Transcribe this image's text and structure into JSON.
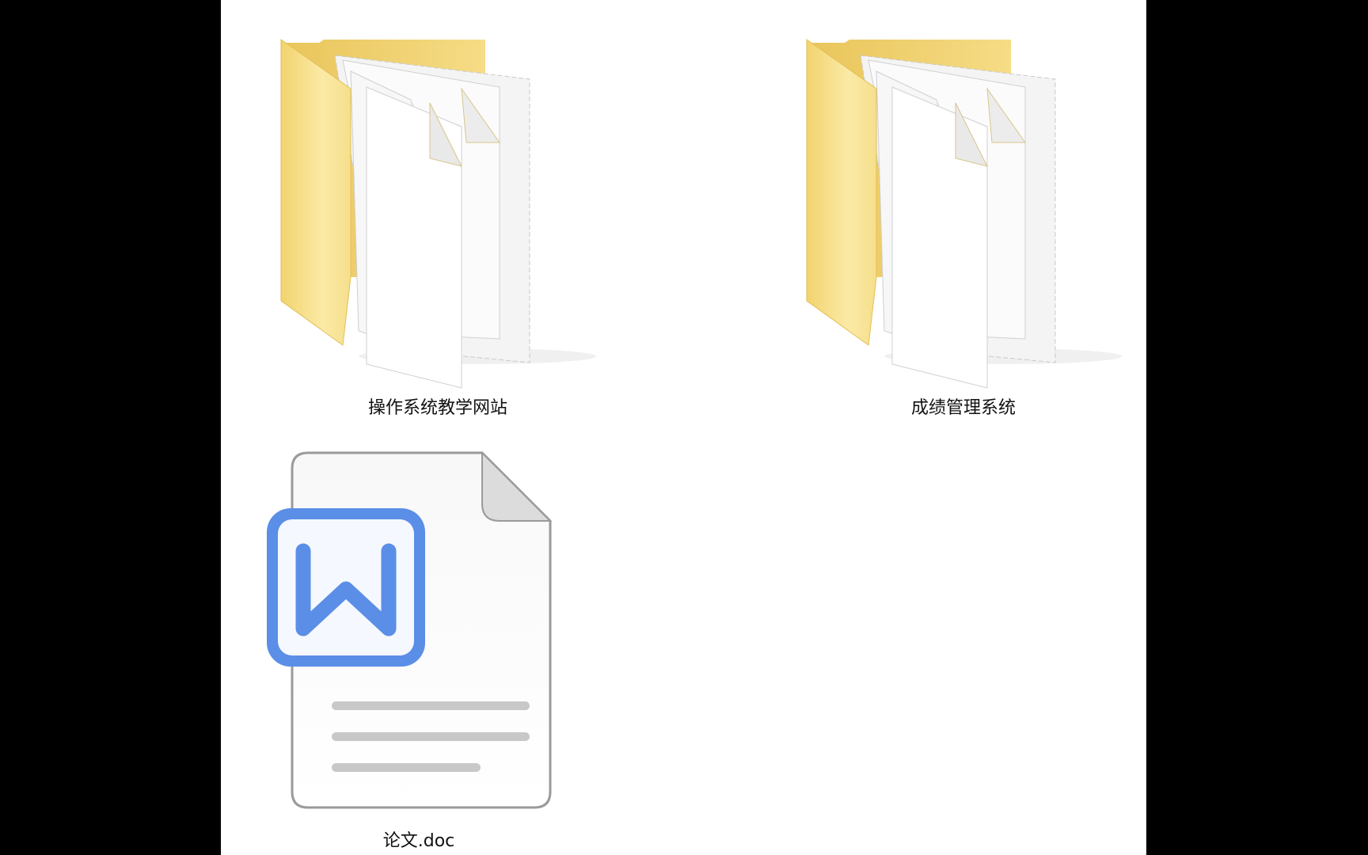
{
  "window": {
    "background_color": "#ffffff",
    "outside_color": "#000000"
  },
  "items": [
    {
      "name": "操作系统教学网站",
      "icon": "folder-icon"
    },
    {
      "name": "成绩管理系统",
      "icon": "folder-icon"
    },
    {
      "name": "论文.doc",
      "icon": "word-document-icon"
    }
  ],
  "colors": {
    "folder_yellow": "#f7d878",
    "word_blue": "#5b8ee6"
  }
}
